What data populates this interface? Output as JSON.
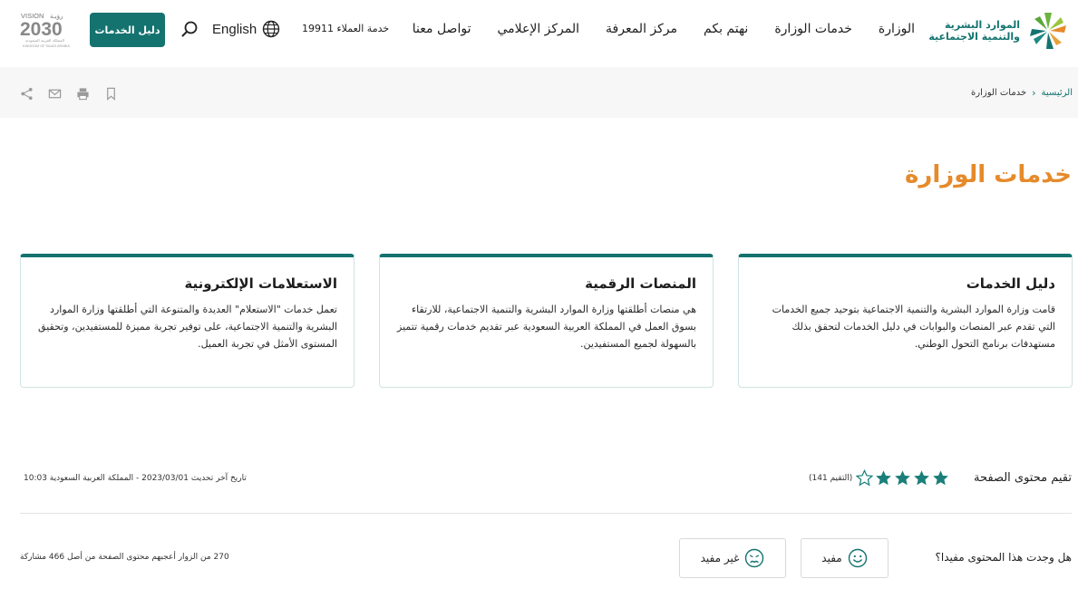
{
  "header": {
    "logo": {
      "line1": "الموارد البشرية",
      "line2": "والتنمية الاجتماعية"
    },
    "nav": [
      {
        "label": "الوزارة"
      },
      {
        "label": "خدمات الوزارة"
      },
      {
        "label": "نهتم بكم"
      },
      {
        "label": "مركز المعرفة"
      },
      {
        "label": "المركز الإعلامي"
      },
      {
        "label": "تواصل معنا"
      }
    ],
    "customer_service": "خدمة العملاء 19911",
    "language": "English",
    "services_guide_button": "دليل الخدمات",
    "vision": {
      "label": "VISION",
      "arabic": "رؤيـة",
      "year": "2030",
      "sub1": "المملكة العربية السعودية",
      "sub2": "KINGDOM OF SAUDI ARABIA"
    }
  },
  "breadcrumb": {
    "home": "الرئيسية",
    "separator": "›",
    "current": "خدمات الوزارة"
  },
  "page_title": "خدمات الوزارة",
  "cards": [
    {
      "title": "دليل الخدمات",
      "body": "قامت وزارة الموارد البشرية والتنمية الاجتماعية بتوحيد جميع الخدمات التي تقدم عبر المنصات والبوابات في دليل الخدمات لتحقق بذلك مستهدفات برنامج التحول الوطني."
    },
    {
      "title": "المنصات الرقمية",
      "body": "هي منصات أطلقتها وزارة الموارد البشرية والتنمية الاجتماعية، للارتقاء بسوق العمل في المملكة العربية السعودية عبر تقديم خدمات رقمية تتميز بالسهولة لجميع المستفيدين."
    },
    {
      "title": "الاستعلامات الإلكترونية",
      "body": "تعمل خدمات \"الاستعلام\" العديدة والمتنوعة التي أطلقتها وزارة الموارد البشرية والتنمية الاجتماعية، على توفير تجربة مميزة للمستفيدين، وتحقيق المستوى الأمثل في تجربة العميل."
    }
  ],
  "rating": {
    "label": "تقيم محتوى الصفحة",
    "stars_filled": 4,
    "stars_total": 5,
    "count_text": "(التقيم 141)",
    "updated_text": "تاريخ آخر تحديث  2023/03/01 - المملكة العربية السعودية 10:03"
  },
  "feedback": {
    "question": "هل وجدت هذا المحتوى مفيدا؟",
    "useful": "مفيد",
    "not_useful": "غير مفيد",
    "stats": "270 من الزوار أعجبهم محتوى الصفحة من أصل 466 مشاركة"
  },
  "colors": {
    "brand_teal": "#14736f",
    "title_orange": "#e68a2a",
    "star_teal": "#1a7f79"
  }
}
